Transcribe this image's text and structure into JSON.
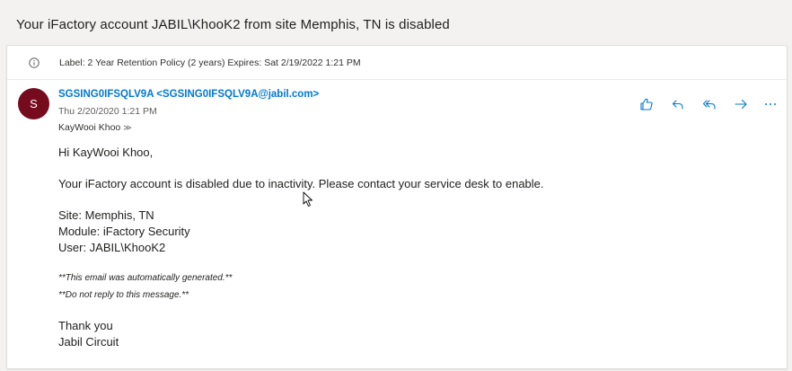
{
  "email": {
    "subject": "Your iFactory account JABIL\\KhooK2 from site Memphis, TN is disabled",
    "retention_label": "Label: 2 Year Retention Policy (2 years) Expires: Sat 2/19/2022 1:21 PM",
    "avatar_initial": "S",
    "sender_display": "SGSING0IFSQLV9A <SGSING0IFSQLV9A@jabil.com>",
    "date": "Thu 2/20/2020 1:21 PM",
    "recipient": "KayWooi Khoo",
    "recipient_chevron": "≫",
    "body": {
      "greeting": "Hi KayWooi Khoo,",
      "message": "Your iFactory account is disabled due to inactivity. Please contact your service desk to enable.",
      "site": "Site: Memphis, TN",
      "module": "Module: iFactory Security",
      "user": "User: JABIL\\KhooK2",
      "note1": "**This email was automatically generated.**",
      "note2": "**Do not reply to this message.**",
      "closing": "Thank you",
      "signature": "Jabil Circuit"
    }
  },
  "icons": {
    "info": "info-icon",
    "like": "thumbs-up-icon",
    "reply": "reply-icon",
    "reply_all": "reply-all-icon",
    "forward": "forward-icon",
    "more": "more-icon"
  },
  "colors": {
    "accent": "#0078d4",
    "avatar_bg": "#750b1c",
    "page_bg": "#f3f2f1"
  }
}
